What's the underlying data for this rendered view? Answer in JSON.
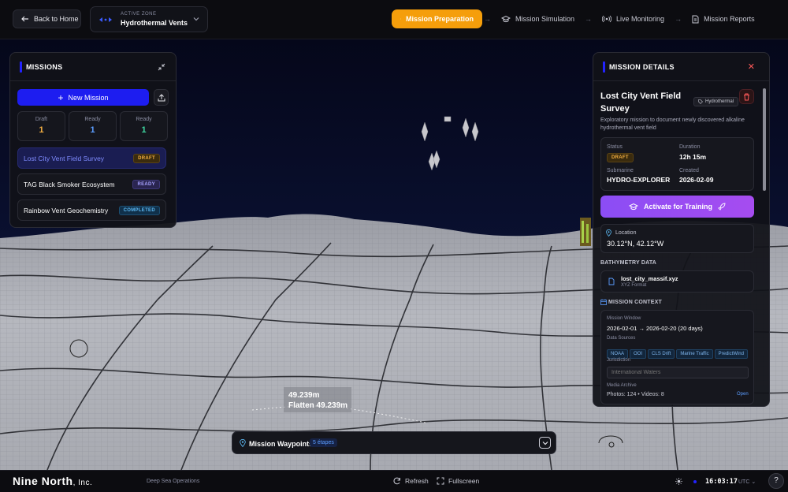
{
  "topbar": {
    "back_label": "Back to Home",
    "zone_label": "ACTIVE ZONE",
    "zone_name": "Hydrothermal Vents",
    "steps": [
      {
        "label": "Mission Preparation",
        "icon": "map-icon",
        "active": true
      },
      {
        "label": "Mission Simulation",
        "icon": "graduation-cap-icon",
        "active": false
      },
      {
        "label": "Live Monitoring",
        "icon": "radio-icon",
        "active": false
      },
      {
        "label": "Mission Reports",
        "icon": "document-icon",
        "active": false
      }
    ],
    "accent": "#f59e0b"
  },
  "missions_panel": {
    "title": "MISSIONS",
    "new_label": "New Mission",
    "stats": [
      {
        "label": "Draft",
        "value": "1",
        "color": "#f5b042"
      },
      {
        "label": "Ready",
        "value": "1",
        "color": "#5b9dff"
      },
      {
        "label": "Ready",
        "value": "1",
        "color": "#3ed6a0"
      }
    ],
    "items": [
      {
        "name": "Lost City Vent Field Survey",
        "status": "DRAFT",
        "selected": true
      },
      {
        "name": "TAG Black Smoker Ecosystem",
        "status": "READY",
        "selected": false
      },
      {
        "name": "Rainbow Vent Geochemistry",
        "status": "COMPLETED",
        "selected": false
      }
    ]
  },
  "details_panel": {
    "title": "MISSION DETAILS",
    "mission_title": "Lost City Vent Field Survey",
    "tag": "Hydrothermal",
    "description": "Exploratory mission to document newly discovered alkaline hydrothermal vent field",
    "status_label": "Status",
    "status_value": "DRAFT",
    "duration_label": "Duration",
    "duration_value": "12h 15m",
    "submarine_label": "Submarine",
    "submarine_value": "HYDRO-EXPLORER",
    "created_label": "Created",
    "created_value": "2026-02-09",
    "activate_label": "Activate for Training",
    "location_label": "Location",
    "location_value": "30.12°N, 42.12°W",
    "bathymetry_label": "BATHYMETRY DATA",
    "file_name": "lost_city_massif.xyz",
    "file_format": "XYZ Format",
    "context_label": "MISSION CONTEXT",
    "window_label": "Mission Window",
    "window_value": "2026-02-01 → 2026-02-20 (20 days)",
    "sources_label": "Data Sources",
    "sources": [
      "NOAA",
      "OOI",
      "CLS Drift",
      "Marine Traffic",
      "PredictWind"
    ],
    "jurisdiction_label": "Jurisdiction",
    "jurisdiction_placeholder": "International Waters",
    "media_label": "Media Archive",
    "media_value": "Photos: 124 • Videos: 8",
    "open_label": "Open"
  },
  "scene": {
    "measure_1": "49.239m",
    "measure_2": "Flatten 49.239m"
  },
  "waypoints": {
    "label": "Mission Waypoints",
    "count": "5 étapes"
  },
  "bottombar": {
    "brand": "Nine North",
    "brand_suffix": ", Inc.",
    "subtitle": "Deep Sea Operations",
    "refresh_label": "Refresh",
    "fullscreen_label": "Fullscreen",
    "time": "16:03:17",
    "timezone": "UTC",
    "help": "?"
  }
}
